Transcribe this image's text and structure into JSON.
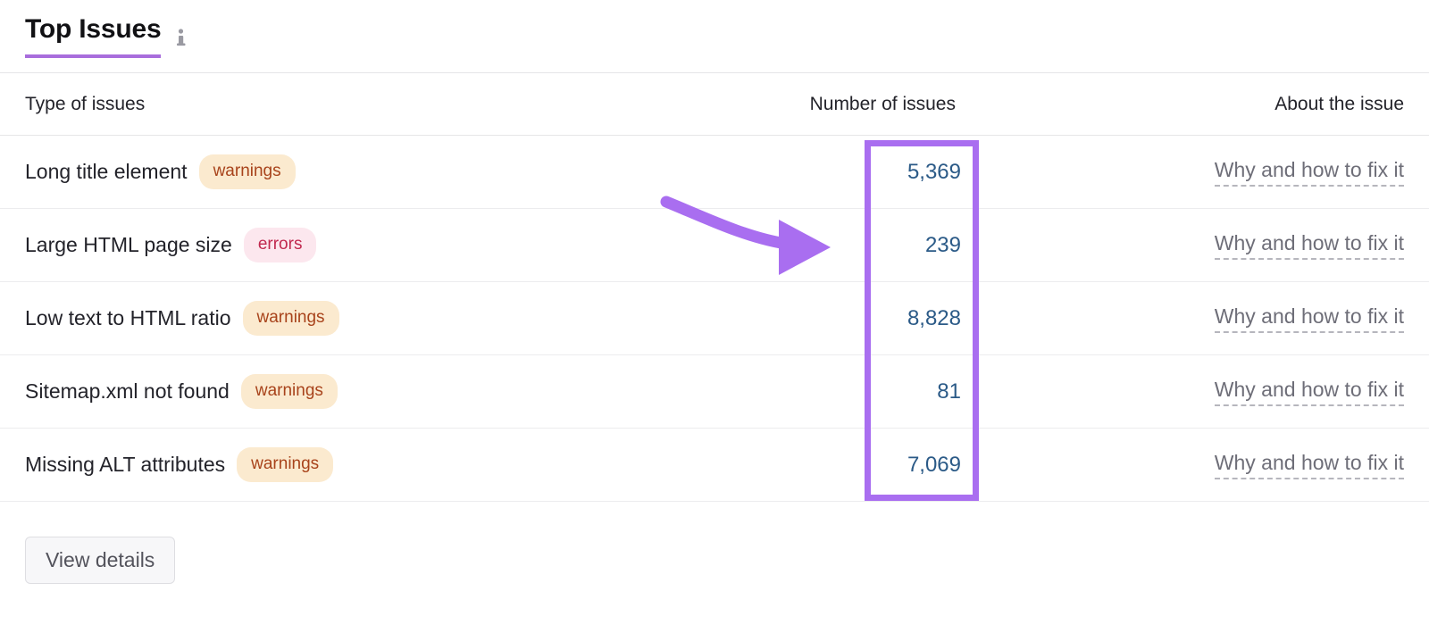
{
  "header": {
    "title": "Top Issues",
    "info_icon": "info-icon"
  },
  "table": {
    "columns": [
      "Type of issues",
      "Number of issues",
      "About the issue"
    ],
    "rows": [
      {
        "issue": "Long title element",
        "badge": "warnings",
        "badge_type": "warnings",
        "count": "5,369",
        "about": "Why and how to fix it"
      },
      {
        "issue": "Large HTML page size",
        "badge": "errors",
        "badge_type": "errors",
        "count": "239",
        "about": "Why and how to fix it"
      },
      {
        "issue": "Low text to HTML ratio",
        "badge": "warnings",
        "badge_type": "warnings",
        "count": "8,828",
        "about": "Why and how to fix it"
      },
      {
        "issue": "Sitemap.xml not found",
        "badge": "warnings",
        "badge_type": "warnings",
        "count": "81",
        "about": "Why and how to fix it"
      },
      {
        "issue": "Missing ALT attributes",
        "badge": "warnings",
        "badge_type": "warnings",
        "count": "7,069",
        "about": "Why and how to fix it"
      }
    ]
  },
  "footer": {
    "view_details_label": "View details"
  },
  "annotations": {
    "highlight_box": "number-of-issues-column",
    "arrow": "curved-arrow-pointing-right",
    "color": "#a96ef0"
  },
  "colors": {
    "title_underline": "#a86ddc",
    "count_text": "#2b5a87",
    "warnings_bg": "#fbeacf",
    "warnings_text": "#a8431b",
    "errors_bg": "#fce7ee",
    "errors_text": "#c1294f",
    "annotation_purple": "#a96ef0"
  }
}
